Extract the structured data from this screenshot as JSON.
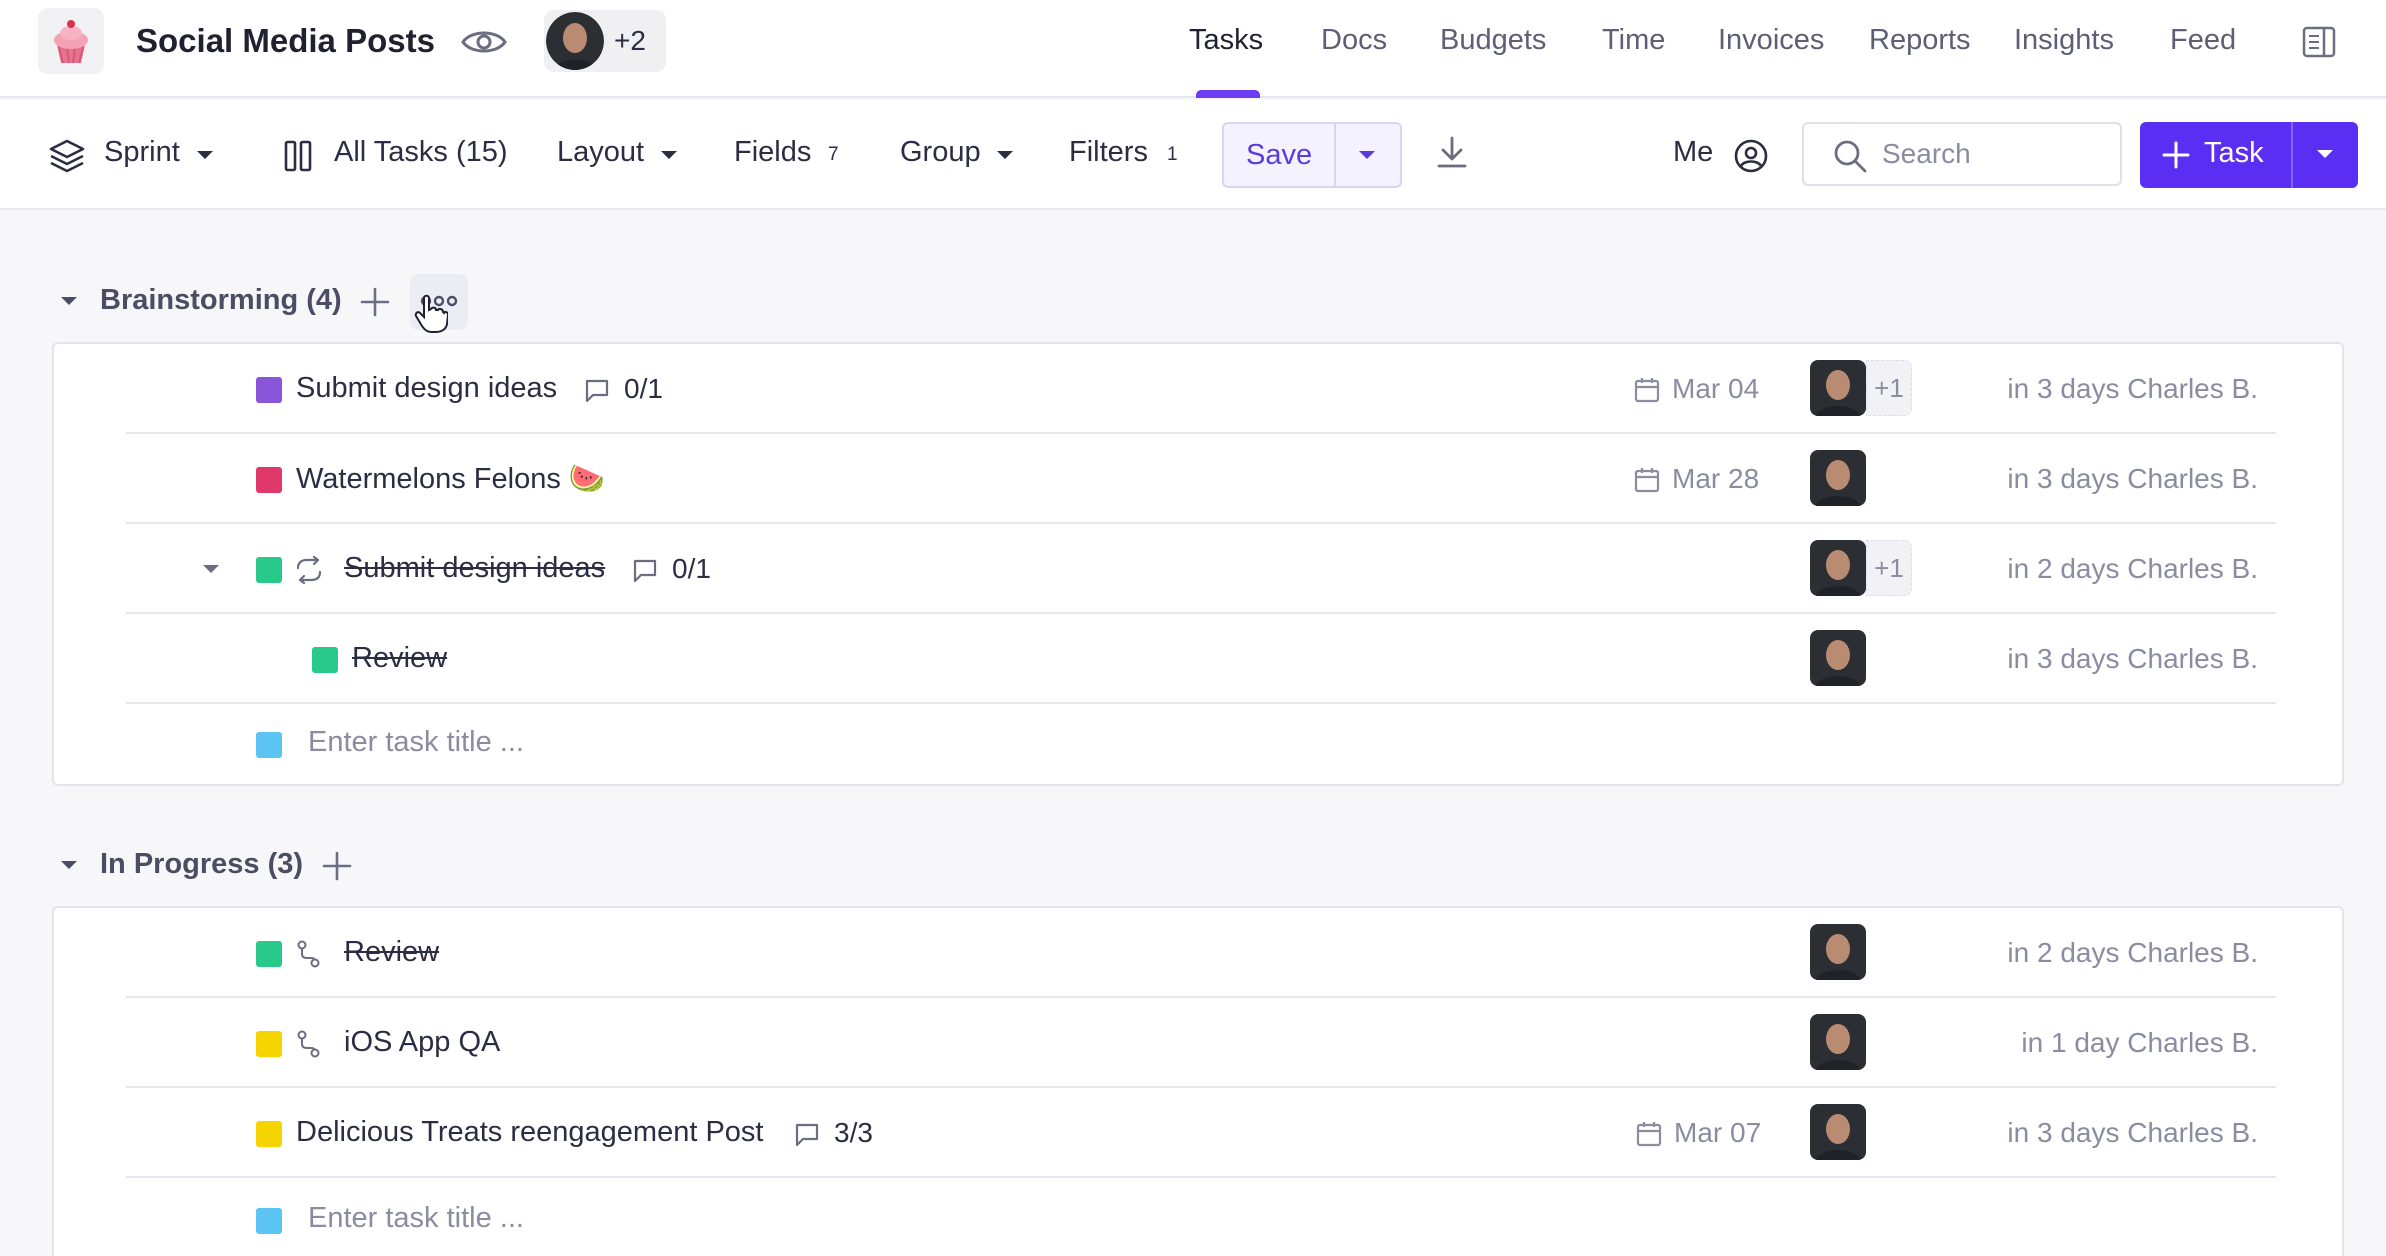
{
  "header": {
    "project_title": "Social Media Posts",
    "members_more": "+2",
    "nav": [
      "Tasks",
      "Docs",
      "Budgets",
      "Time",
      "Invoices",
      "Reports",
      "Insights",
      "Feed"
    ],
    "active_nav": "Tasks"
  },
  "toolbar": {
    "sprint": "Sprint",
    "all_tasks": "All Tasks (15)",
    "layout": "Layout",
    "fields": "Fields",
    "fields_count": "7",
    "group": "Group",
    "filters": "Filters",
    "filters_count": "1",
    "save": "Save",
    "me": "Me",
    "search_placeholder": "Search",
    "task_button": "Task"
  },
  "groups": [
    {
      "title": "Brainstorming (4)",
      "tasks": [
        {
          "title": "Submit design ideas",
          "color": "#8a56d9",
          "checklist": "0/1",
          "date": "Mar 04",
          "assignee_more": "+1",
          "due": "in 3 days Charles B.",
          "done": false
        },
        {
          "title": "Watermelons Felons 🍉",
          "color": "#e0386b",
          "checklist": "",
          "date": "Mar 28",
          "assignee_more": "",
          "due": "in 3 days Charles B.",
          "done": false
        },
        {
          "title": "Submit design ideas",
          "color": "#28c98a",
          "checklist": "0/1",
          "date": "",
          "assignee_more": "+1",
          "due": "in 2 days Charles B.",
          "done": true
        },
        {
          "title": "Review",
          "color": "#28c98a",
          "checklist": "",
          "date": "",
          "assignee_more": "",
          "due": "in 3 days Charles B.",
          "done": true
        }
      ],
      "new_task_placeholder": "Enter task title ..."
    },
    {
      "title": "In Progress (3)",
      "tasks": [
        {
          "title": "Review",
          "color": "#28c98a",
          "checklist": "",
          "date": "",
          "assignee_more": "",
          "due": "in 2 days Charles B.",
          "done": true
        },
        {
          "title": "iOS App QA",
          "color": "#f5d400",
          "checklist": "",
          "date": "",
          "assignee_more": "",
          "due": "in 1 day Charles B.",
          "done": false
        },
        {
          "title": "Delicious Treats reengagement Post",
          "color": "#f5d400",
          "checklist": "3/3",
          "date": "Mar 07",
          "assignee_more": "",
          "due": "in 3 days Charles B.",
          "done": false
        }
      ],
      "new_task_placeholder": "Enter task title ..."
    }
  ],
  "colors": {
    "accent": "#5b2ef3",
    "new_task_square": "#5bc4f2"
  }
}
